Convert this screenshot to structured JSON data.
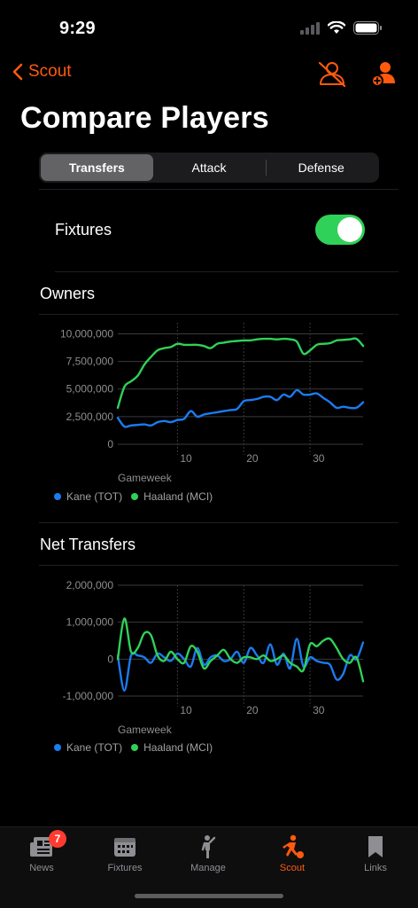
{
  "status": {
    "time": "9:29"
  },
  "nav": {
    "back_label": "Scout"
  },
  "page": {
    "title": "Compare Players"
  },
  "segments": [
    {
      "label": "Transfers",
      "active": true
    },
    {
      "label": "Attack",
      "active": false
    },
    {
      "label": "Defense",
      "active": false
    }
  ],
  "fixtures": {
    "label": "Fixtures",
    "toggle_on": true
  },
  "colors": {
    "accent": "#ff5a0e",
    "kane": "#1a7cf2",
    "haaland": "#30d158",
    "toggle": "#30d158"
  },
  "icons": [
    "chevron-left-icon",
    "hide-player-icon",
    "add-player-icon",
    "news-icon",
    "fixtures-icon",
    "manage-icon",
    "scout-icon",
    "links-icon"
  ],
  "chart_data": [
    {
      "type": "line",
      "title": "Owners",
      "xlabel": "Gameweek",
      "ylabel": "",
      "ylim": [
        0,
        11000000
      ],
      "xlim": [
        1,
        38
      ],
      "x_ticks": [
        10,
        20,
        30
      ],
      "y_ticks": [
        0,
        2500000,
        5000000,
        7500000,
        10000000
      ],
      "y_tick_labels": [
        "0",
        "2,500,000",
        "5,000,000",
        "7,500,000",
        "10,000,000"
      ],
      "grid": true,
      "legend_position": "bottom-left",
      "x": [
        1,
        2,
        3,
        4,
        5,
        6,
        7,
        8,
        9,
        10,
        11,
        12,
        13,
        14,
        15,
        16,
        17,
        18,
        19,
        20,
        21,
        22,
        23,
        24,
        25,
        26,
        27,
        28,
        29,
        30,
        31,
        32,
        33,
        34,
        35,
        36,
        37,
        38
      ],
      "series": [
        {
          "name": "Kane (TOT)",
          "values": [
            2400000,
            1600000,
            1700000,
            1750000,
            1800000,
            1700000,
            2000000,
            2100000,
            2000000,
            2200000,
            2300000,
            3000000,
            2500000,
            2700000,
            2800000,
            2900000,
            3000000,
            3100000,
            3200000,
            3900000,
            4000000,
            4100000,
            4300000,
            4300000,
            4000000,
            4500000,
            4300000,
            4900000,
            4500000,
            4500000,
            4600000,
            4200000,
            3800000,
            3300000,
            3400000,
            3300000,
            3300000,
            3800000
          ]
        },
        {
          "name": "Haaland (MCI)",
          "values": [
            3300000,
            5200000,
            5700000,
            6200000,
            7200000,
            7900000,
            8500000,
            8700000,
            8800000,
            9100000,
            9000000,
            9000000,
            9000000,
            8900000,
            8700000,
            9100000,
            9200000,
            9300000,
            9350000,
            9400000,
            9400000,
            9500000,
            9550000,
            9550000,
            9500000,
            9550000,
            9500000,
            9300000,
            8200000,
            8500000,
            9000000,
            9100000,
            9150000,
            9400000,
            9450000,
            9500000,
            9550000,
            8900000
          ]
        }
      ]
    },
    {
      "type": "line",
      "title": "Net Transfers",
      "xlabel": "Gameweek",
      "ylabel": "",
      "ylim": [
        -1000000,
        2000000
      ],
      "xlim": [
        1,
        38
      ],
      "x_ticks": [
        10,
        20,
        30
      ],
      "y_ticks": [
        -1000000,
        0,
        1000000,
        2000000
      ],
      "y_tick_labels": [
        "-1,000,000",
        "0",
        "1,000,000",
        "2,000,000"
      ],
      "grid": true,
      "legend_position": "bottom-left",
      "x": [
        1,
        2,
        3,
        4,
        5,
        6,
        7,
        8,
        9,
        10,
        11,
        12,
        13,
        14,
        15,
        16,
        17,
        18,
        19,
        20,
        21,
        22,
        23,
        24,
        25,
        26,
        27,
        28,
        29,
        30,
        31,
        32,
        33,
        34,
        35,
        36,
        37,
        38
      ],
      "series": [
        {
          "name": "Kane (TOT)",
          "values": [
            100000,
            -850000,
            100000,
            100000,
            50000,
            -100000,
            150000,
            50000,
            -50000,
            150000,
            0,
            -200000,
            300000,
            -150000,
            50000,
            100000,
            -50000,
            0,
            200000,
            -100000,
            300000,
            100000,
            -100000,
            400000,
            -150000,
            150000,
            -250000,
            550000,
            -200000,
            50000,
            -50000,
            -100000,
            -150000,
            -550000,
            -400000,
            100000,
            0,
            450000
          ]
        },
        {
          "name": "Haaland (MCI)",
          "values": [
            0,
            1100000,
            200000,
            300000,
            700000,
            650000,
            100000,
            -50000,
            200000,
            0,
            -100000,
            350000,
            200000,
            -250000,
            -50000,
            100000,
            250000,
            0,
            -100000,
            50000,
            50000,
            0,
            100000,
            -50000,
            0,
            100000,
            -100000,
            -200000,
            -300000,
            400000,
            350000,
            500000,
            550000,
            300000,
            0,
            -100000,
            50000,
            -600000
          ]
        }
      ]
    }
  ],
  "tabbar": {
    "tabs": [
      {
        "label": "News",
        "badge": "7",
        "active": false
      },
      {
        "label": "Fixtures",
        "active": false
      },
      {
        "label": "Manage",
        "active": false
      },
      {
        "label": "Scout",
        "active": true
      },
      {
        "label": "Links",
        "active": false
      }
    ]
  }
}
